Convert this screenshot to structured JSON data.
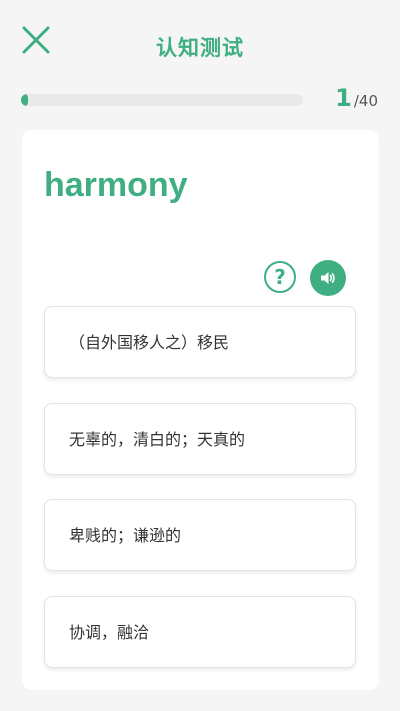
{
  "header": {
    "title": "认知测试",
    "close_icon": "close-icon"
  },
  "progress": {
    "current": "1",
    "separator": "/",
    "total": "40",
    "fraction": 0.025
  },
  "card": {
    "word": "harmony",
    "help_symbol": "?",
    "audio_icon": "speaker-icon"
  },
  "options": [
    {
      "label": "（自外国移人之）移民"
    },
    {
      "label": "无辜的，清白的；天真的"
    },
    {
      "label": "卑贱的；谦逊的"
    },
    {
      "label": "协调，融洽"
    }
  ],
  "colors": {
    "accent": "#3fae83",
    "background": "#f5f5f5",
    "card": "#ffffff"
  }
}
